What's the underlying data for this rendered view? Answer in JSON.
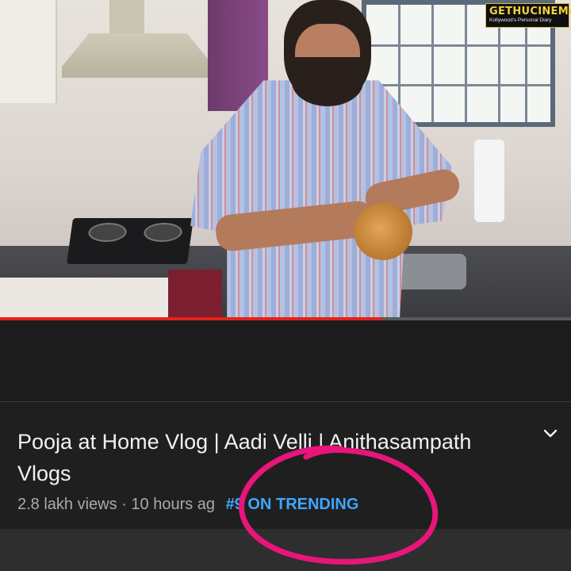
{
  "channel_logo": {
    "name": "GETHUCINEMA",
    "tagline": "Kollywood's Personal Diary"
  },
  "player": {
    "progress": 0.67,
    "progress_color": "#e62117"
  },
  "video_info": {
    "title": "Pooja at Home Vlog | Aadi Velli | Anithasampath Vlogs",
    "views": "2.8 lakh views",
    "separator": "·",
    "time_ago": "10 hours ag",
    "trending_badge": "#9 ON TRENDING",
    "trending_color": "#3ea6ff",
    "expand_icon": "chevron-down-icon"
  },
  "annotation": {
    "type": "hand-drawn circle",
    "color": "#e8157a"
  }
}
